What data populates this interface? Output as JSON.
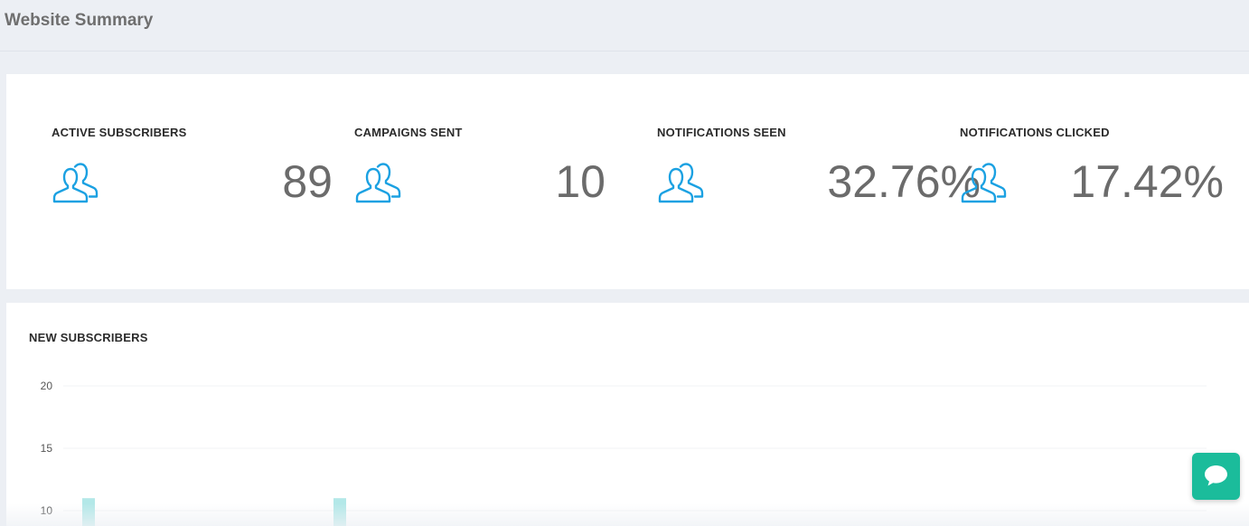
{
  "header": {
    "title": "Website Summary"
  },
  "stats": [
    {
      "label": "ACTIVE SUBSCRIBERS",
      "value": "89",
      "icon": "users-icon"
    },
    {
      "label": "CAMPAIGNS SENT",
      "value": "10",
      "icon": "users-icon"
    },
    {
      "label": "NOTIFICATIONS SEEN",
      "value": "32.76%",
      "icon": "users-icon"
    },
    {
      "label": "NOTIFICATIONS CLICKED",
      "value": "17.42%",
      "icon": "users-icon"
    }
  ],
  "colors": {
    "accent": "#1ba1e2",
    "bar": "#b3e8e8",
    "chat": "#1bbc9b",
    "background": "#eceff4"
  },
  "new_subscribers": {
    "title": "NEW SUBSCRIBERS",
    "chart_data": {
      "type": "bar",
      "title": "NEW SUBSCRIBERS",
      "y_ticks": [
        20,
        15,
        10
      ],
      "visible_y_range": [
        10,
        20
      ],
      "grid": true,
      "visible_bars_note": "two bars visible, both exceed the visible 10 gridline",
      "series": [
        {
          "values": [
            11,
            11
          ]
        }
      ]
    }
  },
  "chat": {
    "icon": "chat-bubble-icon"
  }
}
